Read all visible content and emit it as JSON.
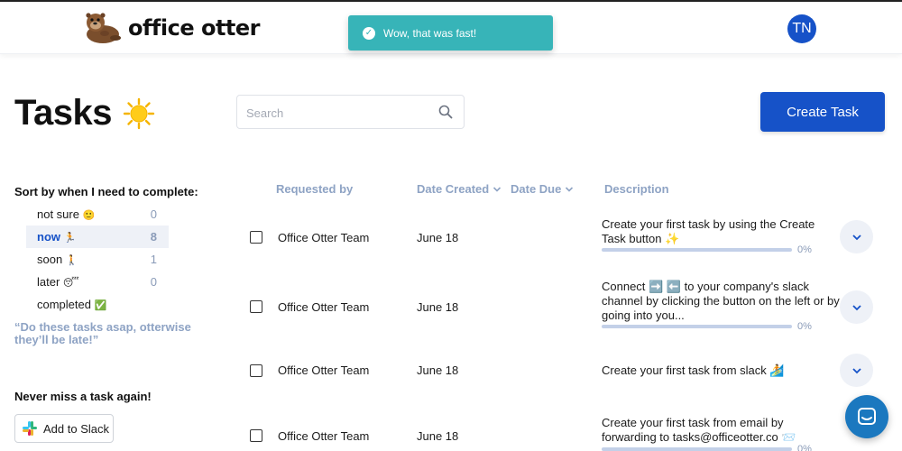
{
  "header": {
    "logo_text": "office otter",
    "avatar_initials": "TN"
  },
  "toast": {
    "message": "Wow, that was fast!"
  },
  "page": {
    "title": "Tasks",
    "search_placeholder": "Search",
    "create_button": "Create Task"
  },
  "sidebar": {
    "sort_title": "Sort by when I need to complete:",
    "items": [
      {
        "label": "not sure",
        "emoji": "🙂",
        "count": "0",
        "active": false
      },
      {
        "label": "now",
        "emoji": "🏃",
        "count": "8",
        "active": true
      },
      {
        "label": "soon",
        "emoji": "🚶",
        "count": "1",
        "active": false
      },
      {
        "label": "later",
        "emoji": "😴",
        "count": "0",
        "active": false
      },
      {
        "label": "completed",
        "emoji": "✅",
        "count": "",
        "active": false
      }
    ],
    "quote": "“Do these tasks asap, otterwise they’ll be late!”",
    "never_miss": "Never miss a task again!",
    "slack_button": "Add to Slack"
  },
  "table": {
    "headers": {
      "requested_by": "Requested by",
      "date_created": "Date Created",
      "date_due": "Date Due",
      "description": "Description"
    },
    "rows": [
      {
        "requested_by": "Office Otter Team",
        "date_created": "June 18",
        "description": "Create your first task by using the Create Task button ✨",
        "progress_pct": "0%",
        "progress": 0
      },
      {
        "requested_by": "Office Otter Team",
        "date_created": "June 18",
        "description": "Connect ➡️ ⬅️  to your company's slack channel by clicking the button on the left or by going into you...",
        "progress_pct": "0%",
        "progress": 0
      },
      {
        "requested_by": "Office Otter Team",
        "date_created": "June 18",
        "description": "Create your first task from slack 🏄",
        "progress_pct": "",
        "progress": 0
      },
      {
        "requested_by": "Office Otter Team",
        "date_created": "June 18",
        "description": "Create your first task from email by forwarding to tasks@officeotter.co 📨",
        "progress_pct": "0%",
        "progress": 0
      }
    ]
  },
  "colors": {
    "primary": "#1652c8",
    "toast": "#37b4b8",
    "muted": "#8ea3c4"
  }
}
